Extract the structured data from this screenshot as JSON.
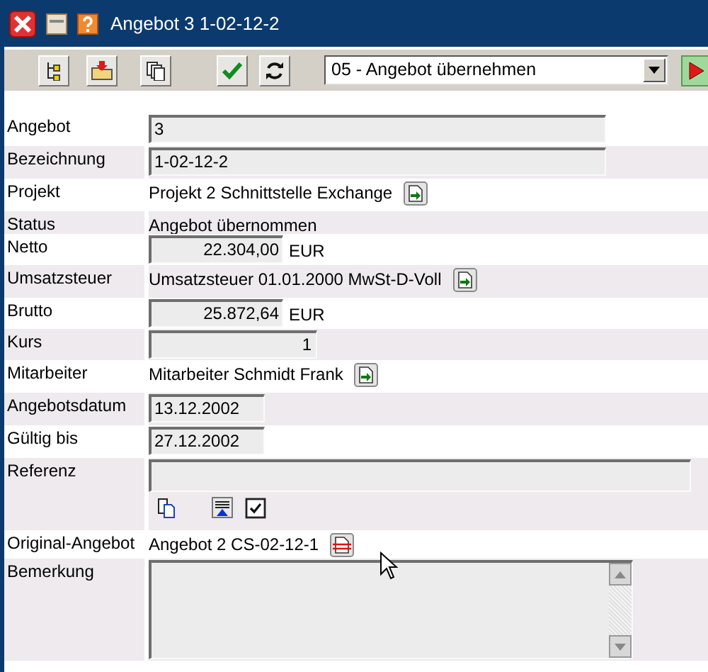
{
  "window": {
    "title": "Angebot 3 1-02-12-2"
  },
  "toolbar": {
    "action_select": {
      "value": "05 - Angebot übernehmen"
    }
  },
  "fields": [
    {
      "label": "Angebot",
      "kind": "input",
      "value": "3"
    },
    {
      "label": "Bezeichnung",
      "kind": "input",
      "value": "1-02-12-2"
    },
    {
      "label": "Projekt",
      "kind": "link",
      "value": "Projekt 2 Schnittstelle Exchange"
    },
    {
      "label": "Status",
      "kind": "text",
      "value": "Angebot übernommen"
    },
    {
      "label": "Netto",
      "kind": "amount",
      "value": "22.304,00",
      "unit": "EUR"
    },
    {
      "label": "Umsatzsteuer",
      "kind": "link",
      "value": "Umsatzsteuer 01.01.2000 MwSt-D-Voll"
    },
    {
      "label": "Brutto",
      "kind": "amount",
      "value": "25.872,64",
      "unit": "EUR"
    },
    {
      "label": "Kurs",
      "kind": "number",
      "value": "1"
    },
    {
      "label": "Mitarbeiter",
      "kind": "link",
      "value": "Mitarbeiter Schmidt Frank"
    },
    {
      "label": "Angebotsdatum",
      "kind": "date",
      "value": "13.12.2002"
    },
    {
      "label": "Gültig bis",
      "kind": "date",
      "value": "27.12.2002"
    },
    {
      "label": "Referenz",
      "kind": "reference"
    },
    {
      "label": "Original-Angebot",
      "kind": "origin",
      "value": "Angebot 2 CS-02-12-1"
    },
    {
      "label": "Bemerkung",
      "kind": "memo"
    }
  ]
}
